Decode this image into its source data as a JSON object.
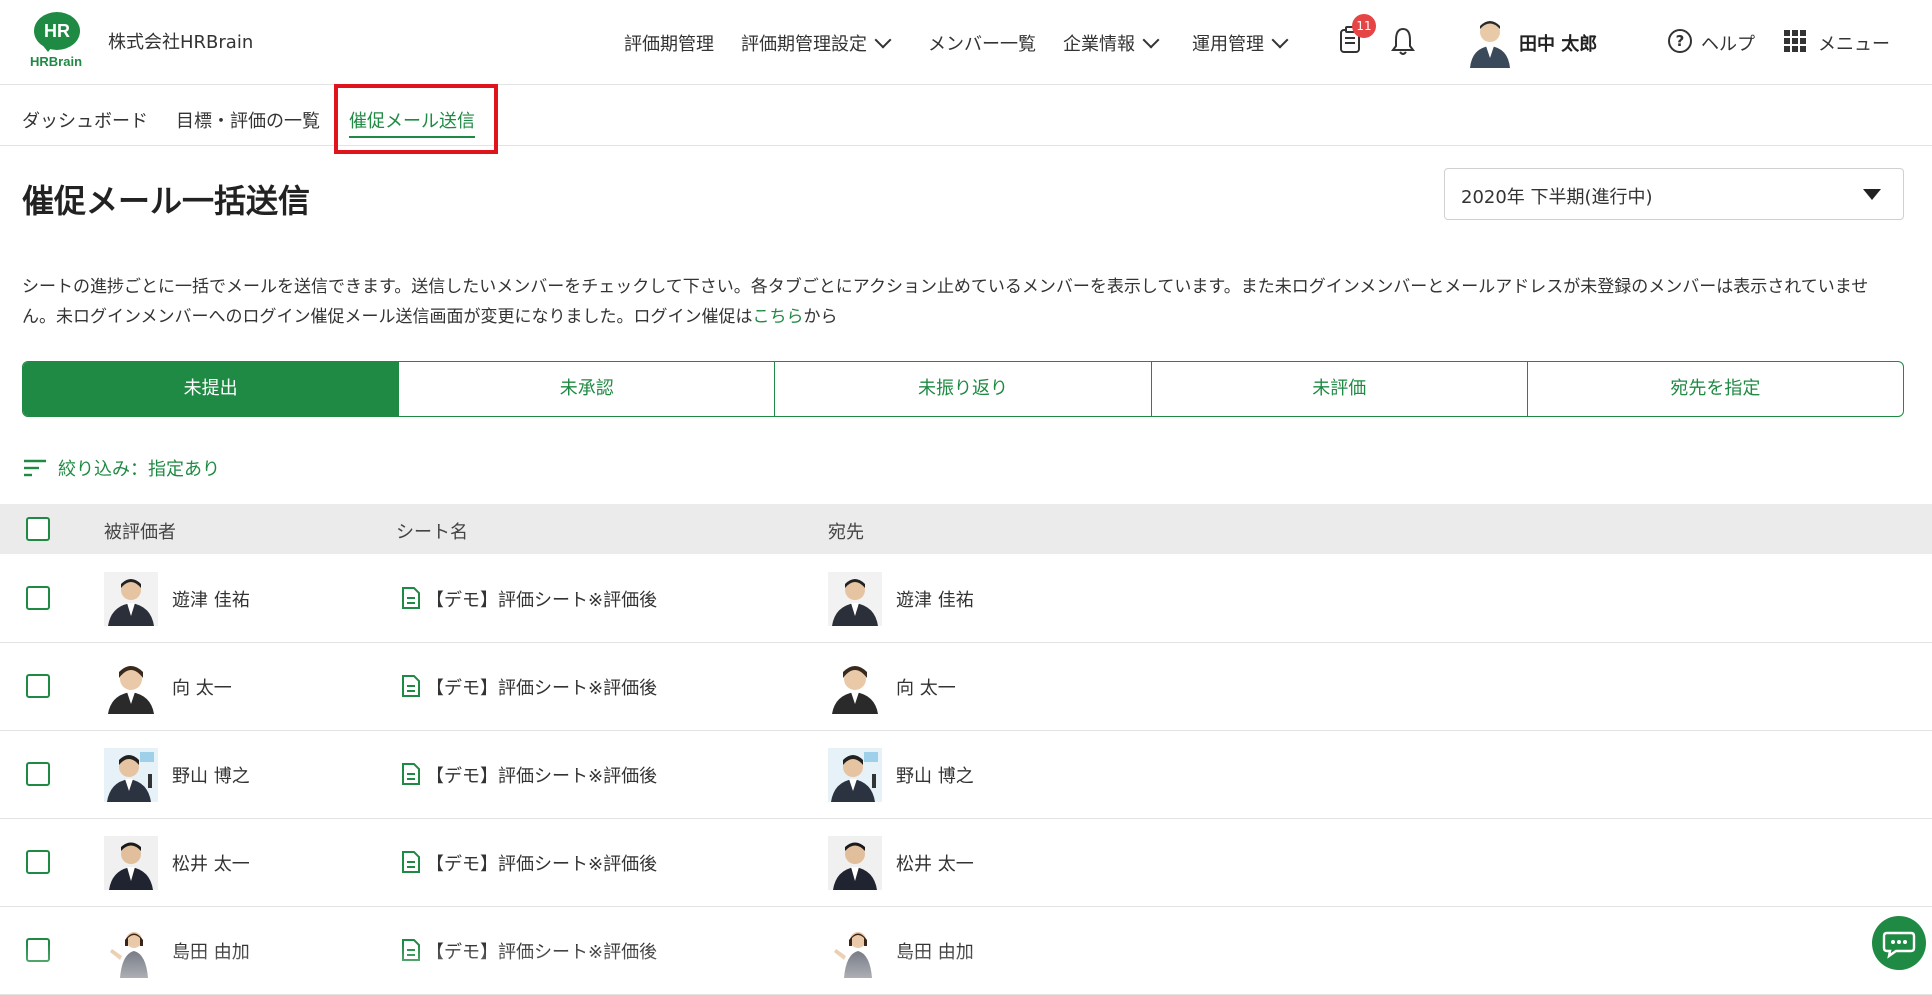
{
  "header": {
    "logo_text": "HR",
    "logo_word": "HRBrain",
    "company": "株式会社HRBrain",
    "nav": [
      {
        "label": "評価期管理",
        "dropdown": false
      },
      {
        "label": "評価期管理設定",
        "dropdown": true
      },
      {
        "label": "メンバー一覧",
        "dropdown": false
      },
      {
        "label": "企業情報",
        "dropdown": true
      },
      {
        "label": "運用管理",
        "dropdown": true
      }
    ],
    "notification_count": "11",
    "user_name": "田中 太郎",
    "help_label": "ヘルプ",
    "menu_label": "メニュー"
  },
  "breadcrumb": [
    "ダッシュボード",
    "目標・評価の一覧",
    "催促メール送信"
  ],
  "page": {
    "title": "催促メール一括送信",
    "period_selected": "2020年 下半期(進行中)",
    "description": "シートの進捗ごとに一括でメールを送信できます。送信したいメンバーをチェックして下さい。各タブごとにアクション止めているメンバーを表示しています。また未ログインメンバーとメールアドレスが未登録のメンバーは表示されていません。未ログインメンバーへのログイン催促メール送信画面が変更になりました。ログイン催促は",
    "description_link": "こちら",
    "description_tail": "から"
  },
  "tabs": [
    "未提出",
    "未承認",
    "未振り返り",
    "未評価",
    "宛先を指定"
  ],
  "selected_tab": "未提出",
  "filter_label": "絞り込み：指定あり",
  "table": {
    "columns": [
      "被評価者",
      "シート名",
      "宛先"
    ],
    "rows": [
      {
        "evaluatee": "遊津 佳祐",
        "sheet": "【デモ】評価シート※評価後",
        "recipient": "遊津 佳祐"
      },
      {
        "evaluatee": "向 太一",
        "sheet": "【デモ】評価シート※評価後",
        "recipient": "向 太一"
      },
      {
        "evaluatee": "野山 博之",
        "sheet": "【デモ】評価シート※評価後",
        "recipient": "野山 博之"
      },
      {
        "evaluatee": "松井 太一",
        "sheet": "【デモ】評価シート※評価後",
        "recipient": "松井 太一"
      },
      {
        "evaluatee": "島田 由加",
        "sheet": "【デモ】評価シート※評価後",
        "recipient": "島田 由加"
      }
    ]
  },
  "colors": {
    "accent": "#1f8a43",
    "badge": "#e64545",
    "highlight": "#e0141c"
  },
  "icons": [
    "document-icon",
    "bell-icon",
    "help-icon",
    "grid-menu-icon",
    "filter-icon",
    "chat-icon",
    "chevron-down-icon"
  ]
}
